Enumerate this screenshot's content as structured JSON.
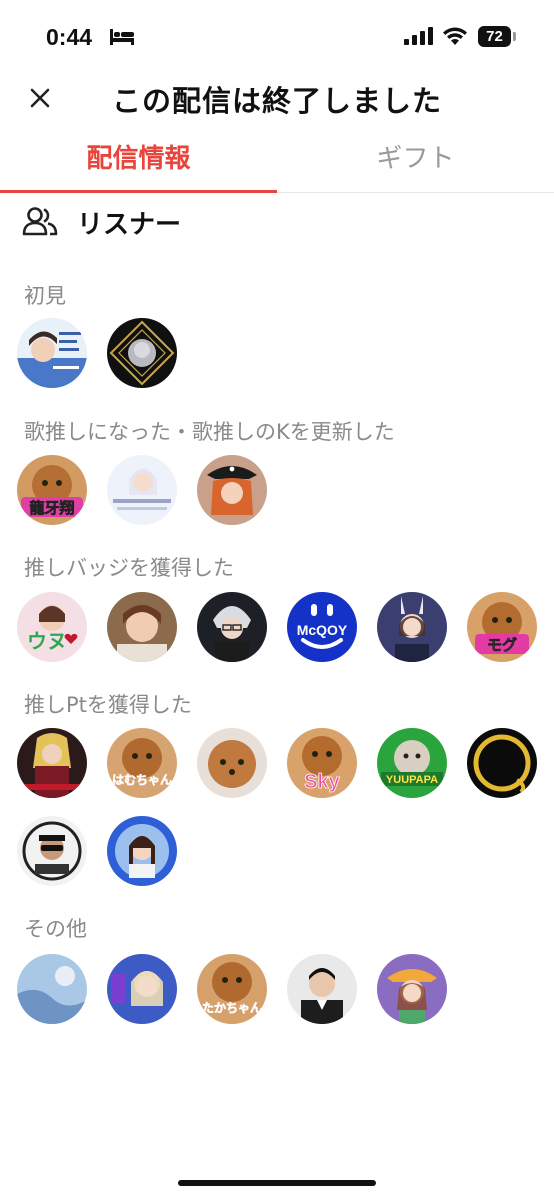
{
  "status_bar": {
    "time": "0:44",
    "battery": "72"
  },
  "header": {
    "title": "この配信は終了しました"
  },
  "tabs": [
    {
      "label": "配信情報",
      "active": true
    },
    {
      "label": "ギフト",
      "active": false
    }
  ],
  "accent_color": "#e8453c",
  "listeners": {
    "heading": "リスナー",
    "sections": [
      {
        "label": "初見",
        "avatars": [
          {
            "text": ""
          },
          {
            "text": ""
          }
        ]
      },
      {
        "label": "歌推しになった・歌推しのKを更新した",
        "avatars": [
          {
            "text": "龍牙翔"
          },
          {
            "text": ""
          },
          {
            "text": ""
          }
        ]
      },
      {
        "label": "推しバッジを獲得した",
        "avatars": [
          {
            "text": "ウヌ"
          },
          {
            "text": ""
          },
          {
            "text": ""
          },
          {
            "text": "McQOY"
          },
          {
            "text": ""
          },
          {
            "text": "モグ"
          }
        ]
      },
      {
        "label": "推しPtを獲得した",
        "avatars": [
          {
            "text": ""
          },
          {
            "text": "はむちゃん"
          },
          {
            "text": ""
          },
          {
            "text": "Sky"
          },
          {
            "text": "YUUPAPA"
          },
          {
            "text": ""
          },
          {
            "text": ""
          },
          {
            "text": ""
          }
        ]
      },
      {
        "label": "その他",
        "avatars": [
          {
            "text": ""
          },
          {
            "text": ""
          },
          {
            "text": "たかちゃん"
          },
          {
            "text": ""
          },
          {
            "text": ""
          }
        ]
      }
    ]
  }
}
